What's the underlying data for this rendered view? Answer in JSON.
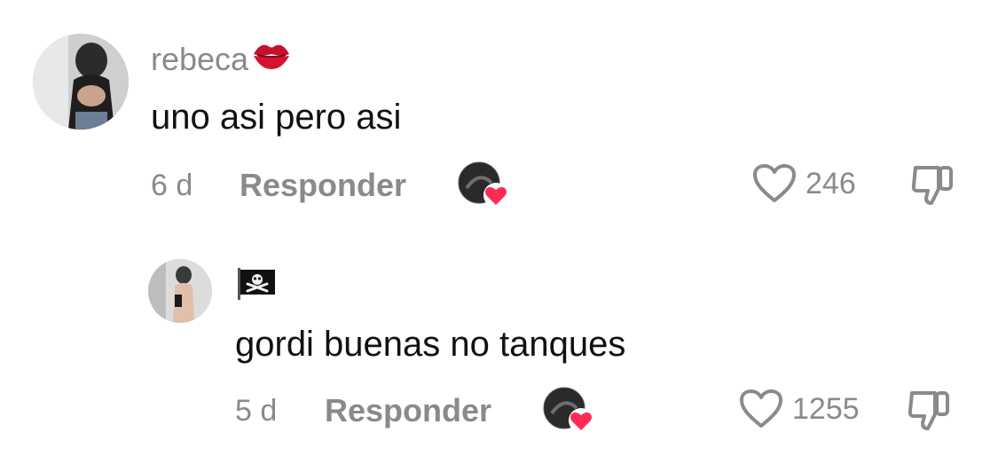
{
  "comments": [
    {
      "username": "rebeca",
      "username_emoji": "lips-icon",
      "text": "uno asi pero asi",
      "time": "6 d",
      "reply_label": "Responder",
      "likes": "246"
    },
    {
      "username": "",
      "username_emoji": "pirate-flag-icon",
      "text": "gordi buenas no tanques",
      "time": "5 d",
      "reply_label": "Responder",
      "likes": "1255"
    }
  ],
  "colors": {
    "muted_text": "#8a8a8a",
    "body_text": "#111111",
    "heart_accent": "#fe2c55"
  }
}
